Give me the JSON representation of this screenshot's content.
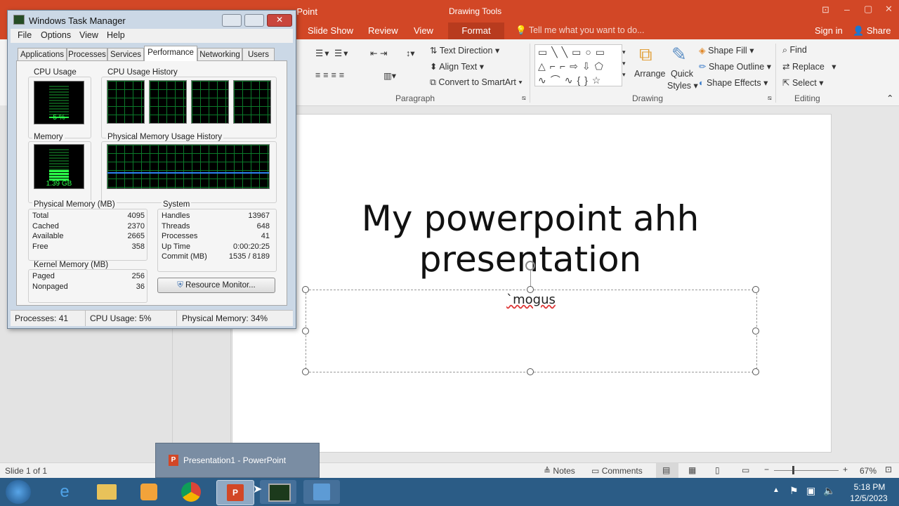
{
  "ppt": {
    "title_fragment": "rPoint",
    "contextual_tab_group": "Drawing Tools",
    "window_controls": {
      "ribbon_options": "⊡",
      "minimize": "–",
      "restore": "▢",
      "close": "✕"
    },
    "tabs": [
      "Slide Show",
      "Review",
      "View",
      "Format"
    ],
    "tell_me": "Tell me what you want to do...",
    "sign_in": "Sign in",
    "share": "Share",
    "ribbon": {
      "paragraph": {
        "label": "Paragraph",
        "text_direction": "Text Direction",
        "align_text": "Align Text",
        "convert_smartart": "Convert to SmartArt"
      },
      "drawing": {
        "label": "Drawing",
        "arrange": "Arrange",
        "quick_styles_line1": "Quick",
        "quick_styles_line2": "Styles",
        "shape_fill": "Shape Fill",
        "shape_outline": "Shape Outline",
        "shape_effects": "Shape Effects"
      },
      "editing": {
        "label": "Editing",
        "find": "Find",
        "replace": "Replace",
        "select": "Select"
      }
    },
    "slide": {
      "title_line1": "My powerpoint ahh",
      "title_line2": "presentation",
      "subtitle": "`mogus"
    },
    "status": {
      "slide_info": "Slide 1 of 1",
      "notes": "Notes",
      "comments": "Comments",
      "zoom": "67%"
    }
  },
  "taskbar": {
    "preview_label": "Presentation1 - PowerPoint",
    "clock_time": "5:18 PM",
    "clock_date": "12/5/2023"
  },
  "task_manager": {
    "title": "Windows Task Manager",
    "menu": [
      "File",
      "Options",
      "View",
      "Help"
    ],
    "tabs": [
      "Applications",
      "Processes",
      "Services",
      "Performance",
      "Networking",
      "Users"
    ],
    "active_tab": "Performance",
    "cpu_usage_label": "CPU Usage",
    "cpu_usage_value": "5 %",
    "cpu_usage_fraction": 0.05,
    "cpu_history_label": "CPU Usage History",
    "memory_label": "Memory",
    "memory_value": "1.39 GB",
    "memory_fraction": 0.34,
    "phys_history_label": "Physical Memory Usage History",
    "physical_memory": {
      "header": "Physical Memory (MB)",
      "rows": [
        {
          "k": "Total",
          "v": "4095"
        },
        {
          "k": "Cached",
          "v": "2370"
        },
        {
          "k": "Available",
          "v": "2665"
        },
        {
          "k": "Free",
          "v": "358"
        }
      ]
    },
    "system": {
      "header": "System",
      "rows": [
        {
          "k": "Handles",
          "v": "13967"
        },
        {
          "k": "Threads",
          "v": "648"
        },
        {
          "k": "Processes",
          "v": "41"
        },
        {
          "k": "Up Time",
          "v": "0:00:20:25"
        },
        {
          "k": "Commit (MB)",
          "v": "1535 / 8189"
        }
      ]
    },
    "kernel_memory": {
      "header": "Kernel Memory (MB)",
      "rows": [
        {
          "k": "Paged",
          "v": "256"
        },
        {
          "k": "Nonpaged",
          "v": "36"
        }
      ]
    },
    "resource_monitor_button": "Resource Monitor...",
    "statusbar": {
      "processes": "Processes: 41",
      "cpu": "CPU Usage: 5%",
      "memory": "Physical Memory: 34%"
    }
  }
}
